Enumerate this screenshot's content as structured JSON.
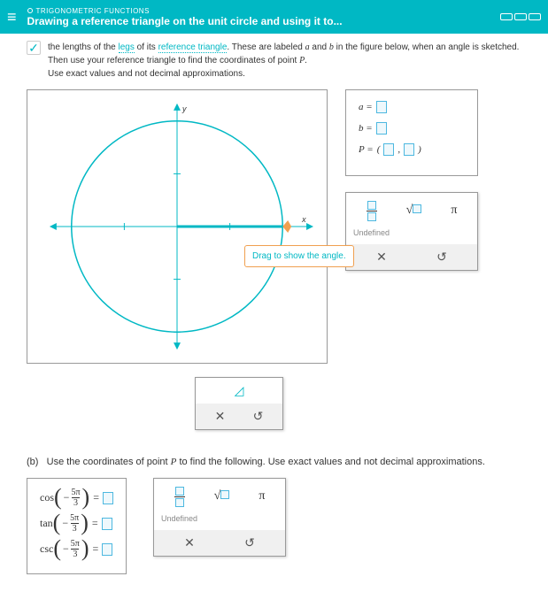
{
  "header": {
    "category": "TRIGONOMETRIC FUNCTIONS",
    "title": "Drawing a reference triangle on the unit circle and using it to..."
  },
  "intro": {
    "line1a": "the lengths of the ",
    "legs": "legs",
    "line1b": " of its ",
    "ref": "reference triangle",
    "line1c": ". These are labeled ",
    "var_a": "a",
    "line1d": " and ",
    "var_b": "b",
    "line1e": " in the figure below, when an angle is sketched.",
    "line2a": "Then use your reference triangle to find the coordinates of point ",
    "var_p": "P",
    "line2b": ".",
    "line3": "Use exact values and not decimal approximations."
  },
  "diagram": {
    "ylabel": "y",
    "xlabel": "x",
    "drag_hint": "Drag to show the angle."
  },
  "answers": {
    "a_label": "a =",
    "b_label": "b =",
    "p_label": "P =",
    "paren_l": "(",
    "comma": ",",
    "paren_r": ")"
  },
  "toolbox": {
    "sqrt": "√",
    "pi": "π",
    "undefined": "Undefined",
    "close": "✕",
    "reset": "↺"
  },
  "small_tool": {
    "angle": "◿"
  },
  "partb": {
    "label_prefix": "(b)",
    "label_text": "Use the coordinates of point ",
    "var_p": "P",
    "label_suffix": " to find the following. Use exact values and not decimal approximations.",
    "eqs": [
      {
        "fn": "cos",
        "arg_num": "5π",
        "arg_den": "3"
      },
      {
        "fn": "tan",
        "arg_num": "5π",
        "arg_den": "3"
      },
      {
        "fn": "csc",
        "arg_num": "5π",
        "arg_den": "3"
      }
    ],
    "minus": "−",
    "equals": "="
  }
}
